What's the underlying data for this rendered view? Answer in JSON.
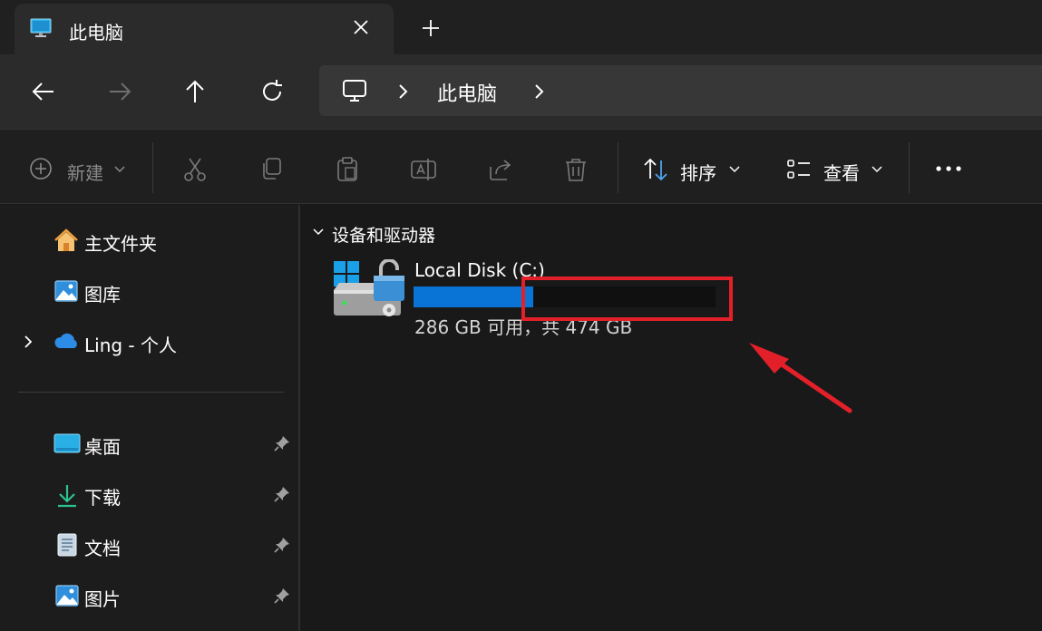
{
  "window": {
    "tab_title": "此电脑",
    "colors": {
      "accent": "#0a74d6",
      "background": "#191919",
      "annotation": "#e3202a"
    }
  },
  "nav": {
    "back_icon": "arrow-left-icon",
    "forward_icon": "arrow-right-icon",
    "up_icon": "arrow-up-icon",
    "refresh_icon": "refresh-icon",
    "breadcrumb": {
      "root_icon": "monitor-icon",
      "label": "此电脑"
    }
  },
  "toolbar": {
    "new_label": "新建",
    "cut_icon": "scissors-icon",
    "copy_icon": "copy-icon",
    "paste_icon": "clipboard-icon",
    "rename_icon": "rename-icon",
    "share_icon": "share-icon",
    "delete_icon": "trash-icon",
    "sort_label": "排序",
    "view_label": "查看",
    "more_icon": "more-icon"
  },
  "sidebar": {
    "top_items": [
      {
        "label": "主文件夹",
        "icon": "home-icon"
      },
      {
        "label": "图库",
        "icon": "gallery-icon"
      },
      {
        "label": "Ling - 个人",
        "icon": "onedrive-cloud-icon"
      }
    ],
    "pinned_items": [
      {
        "label": "桌面",
        "icon": "desktop-icon"
      },
      {
        "label": "下载",
        "icon": "download-icon"
      },
      {
        "label": "文档",
        "icon": "document-icon"
      },
      {
        "label": "图片",
        "icon": "pictures-icon"
      }
    ]
  },
  "main": {
    "group_header": "设备和驱动器",
    "drives": [
      {
        "name": "Local Disk (C:)",
        "space_text": "286 GB 可用，共 474 GB",
        "used_fraction": 0.397,
        "icon": "windows-drive-unlocked-icon"
      }
    ]
  }
}
